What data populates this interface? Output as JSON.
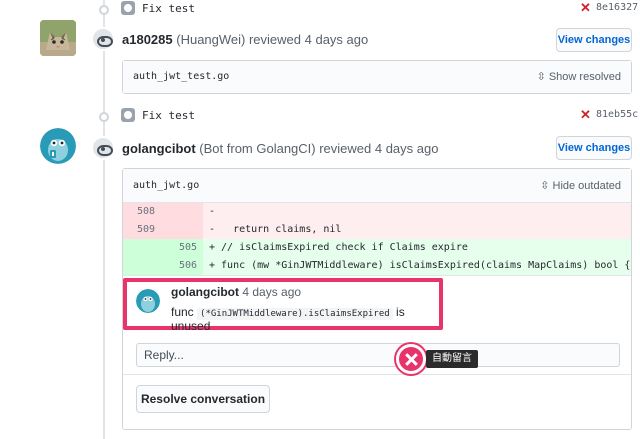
{
  "commits": [
    {
      "message": "Fix test",
      "sha": "8e16327",
      "status": "fail"
    },
    {
      "message": "Fix test",
      "sha": "81eb55c",
      "status": "fail"
    }
  ],
  "reviews": [
    {
      "username": "a180285",
      "display": "(HuangWei) reviewed 4 days ago",
      "button": "View changes",
      "file": "auth_jwt_test.go",
      "toggle": "Show resolved"
    },
    {
      "username": "golangcibot",
      "display": "(Bot from GolangCI) reviewed 4 days ago",
      "button": "View changes",
      "file": "auth_jwt.go",
      "toggle": "Hide outdated"
    }
  ],
  "diff": {
    "lines": [
      {
        "type": "del",
        "old": "508",
        "new": "",
        "code": "-"
      },
      {
        "type": "del",
        "old": "509",
        "new": "",
        "code": "-   return claims, nil"
      },
      {
        "type": "add",
        "old": "",
        "new": "505",
        "code": "+ // isClaimsExpired check if Claims expire"
      },
      {
        "type": "add",
        "old": "",
        "new": "506",
        "code": "+ func (mw *GinJWTMiddleware) isClaimsExpired(claims MapClaims) bool {"
      }
    ]
  },
  "comment": {
    "author": "golangcibot",
    "time": "4 days ago",
    "text_prefix": "func",
    "code": "(*GinJWTMiddleware).isClaimsExpired",
    "text_suffix": "is unused"
  },
  "reply": {
    "placeholder": "Reply..."
  },
  "resolve": {
    "label": "Resolve conversation"
  },
  "annotation": {
    "label": "自動留言"
  },
  "colors": {
    "accent": "#0366d6",
    "highlight": "#e8336b",
    "fail": "#cb2431",
    "del_bg": "#ffeef0",
    "add_bg": "#e6ffed"
  },
  "icons": [
    "commit-icon",
    "x-icon",
    "eye-icon",
    "unfold-icon",
    "close-icon"
  ]
}
